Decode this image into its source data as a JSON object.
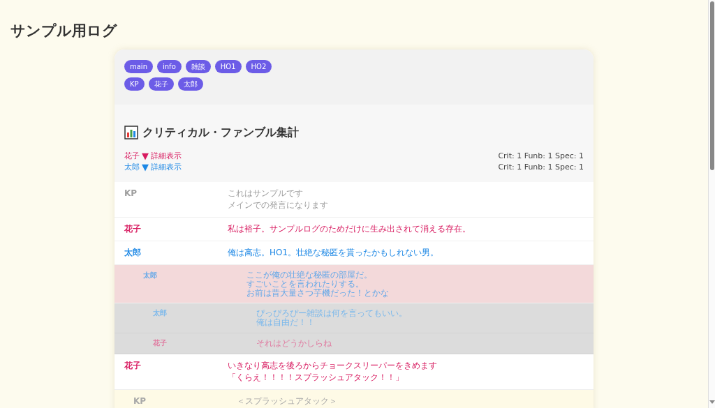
{
  "title": "サンプル用ログ",
  "channel_tabs": [
    {
      "label": "main"
    },
    {
      "label": "info"
    },
    {
      "label": "雑談"
    },
    {
      "label": "HO1"
    },
    {
      "label": "HO2"
    }
  ],
  "character_tabs": [
    {
      "label": "KP"
    },
    {
      "label": "花子"
    },
    {
      "label": "太郎"
    }
  ],
  "summary": {
    "title": "クリティカル・ファンブル集計",
    "items": [
      {
        "name": "花子",
        "color": "#d81b60",
        "toggle": "▼",
        "link": "詳細表示",
        "stats": "Crit: 1 Funb: 1 Spec: 1"
      },
      {
        "name": "太郎",
        "color": "#1e88e5",
        "toggle": "▼",
        "link": "詳細表示",
        "stats": "Crit: 1 Funb: 1 Spec: 1"
      }
    ]
  },
  "messages": [
    {
      "kind": "main",
      "speaker": "KP",
      "color": "#9e9e9e",
      "lines": [
        "これはサンプルです",
        "メインでの発言になります"
      ]
    },
    {
      "kind": "main",
      "speaker": "花子",
      "color": "#d81b60",
      "lines": [
        "私は裕子。サンプルログのためだけに生み出されて消える存在。"
      ]
    },
    {
      "kind": "main",
      "speaker": "太郎",
      "color": "#1e88e5",
      "lines": [
        "俺は高志。HO1。壮絶な秘匿を貰ったかもしれない男。"
      ]
    },
    {
      "kind": "secret",
      "speaker": "太郎",
      "color": "#64a8e8",
      "lines": [
        "ここが俺の壮絶な秘匿の部屋だ。",
        "すごいことを言われたりする。",
        "お前は昔大量さつ芋機だった！とかな"
      ]
    },
    {
      "kind": "chat",
      "speaker": "太郎",
      "color": "#7ab8ec",
      "lines": [
        "ぴっぴろぴー雑談は何を言ってもいい。",
        "俺は自由だ！！"
      ]
    },
    {
      "kind": "chat",
      "speaker": "花子",
      "color": "#e07aa0",
      "lines": [
        "それはどうかしらね"
      ]
    },
    {
      "kind": "main",
      "speaker": "花子",
      "color": "#d81b60",
      "lines": [
        "いきなり高志を後ろからチョークスリーパーをきめます",
        "「くらえ！！！！スプラッシュアタック！！」"
      ]
    },
    {
      "kind": "info",
      "speaker": "KP",
      "color": "#a8a8a8",
      "lines": [
        "＜スプラッシュアタック＞"
      ]
    }
  ]
}
